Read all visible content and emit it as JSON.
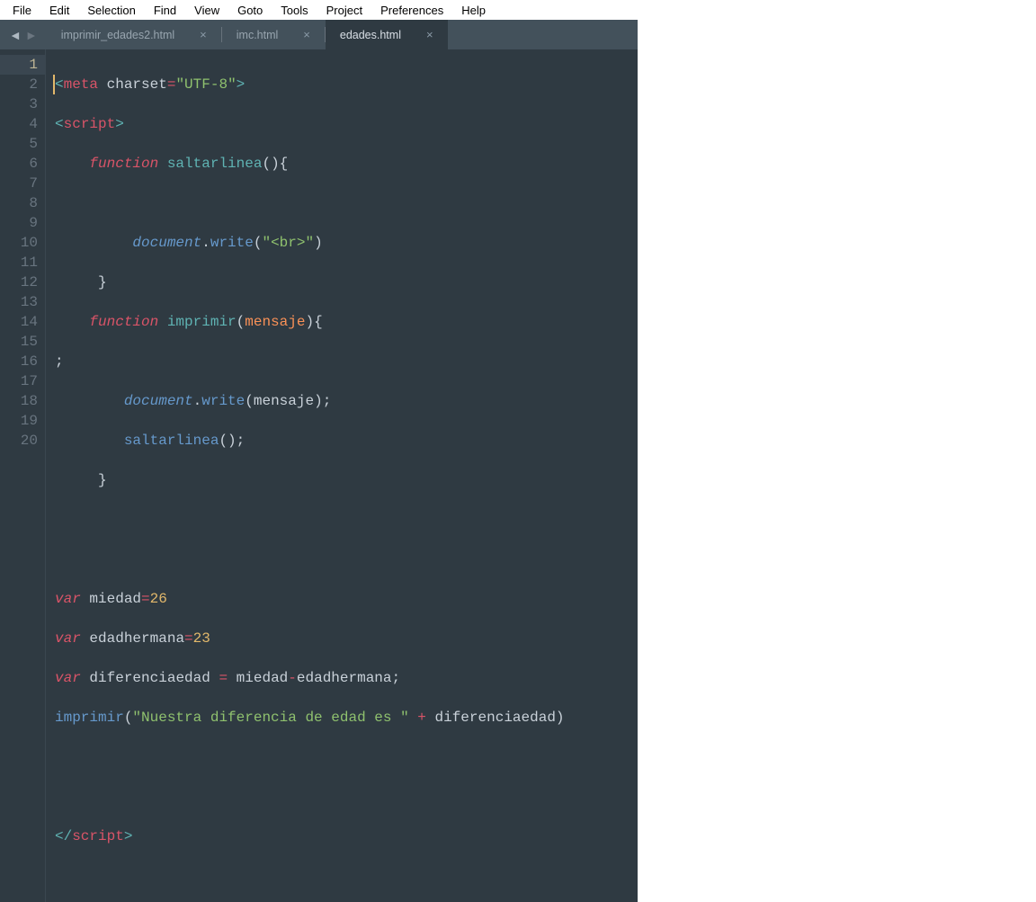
{
  "menu": [
    "File",
    "Edit",
    "Selection",
    "Find",
    "View",
    "Goto",
    "Tools",
    "Project",
    "Preferences",
    "Help"
  ],
  "tabs": [
    {
      "label": "imprimir_edades2.html",
      "active": false
    },
    {
      "label": "imc.html",
      "active": false
    },
    {
      "label": "edades.html",
      "active": true
    }
  ],
  "lineCount": 20,
  "activeLine": 1,
  "tokens": {
    "meta": "meta",
    "charset": "charset",
    "utf8": "\"UTF-8\"",
    "script": "script",
    "function": "function",
    "saltarlinea": "saltarlinea",
    "document": "document",
    "write": "write",
    "brStr": "\"<br>\"",
    "imprimir": "imprimir",
    "mensaje": "mensaje",
    "var": "var",
    "miedad": "miedad",
    "n26": "26",
    "edadhermana": "edadhermana",
    "n23": "23",
    "diferenciaedad": "diferenciaedad",
    "sentence": "\"Nuestra diferencia de edad es \"",
    "eq": "=",
    "minus": "-",
    "plus": "+",
    "semi": ";",
    "lt": "<",
    "gt": ">",
    "lto": "</",
    "lp": "(",
    "rp": ")",
    "lb": "{",
    "rb": "}",
    "dot": "."
  }
}
